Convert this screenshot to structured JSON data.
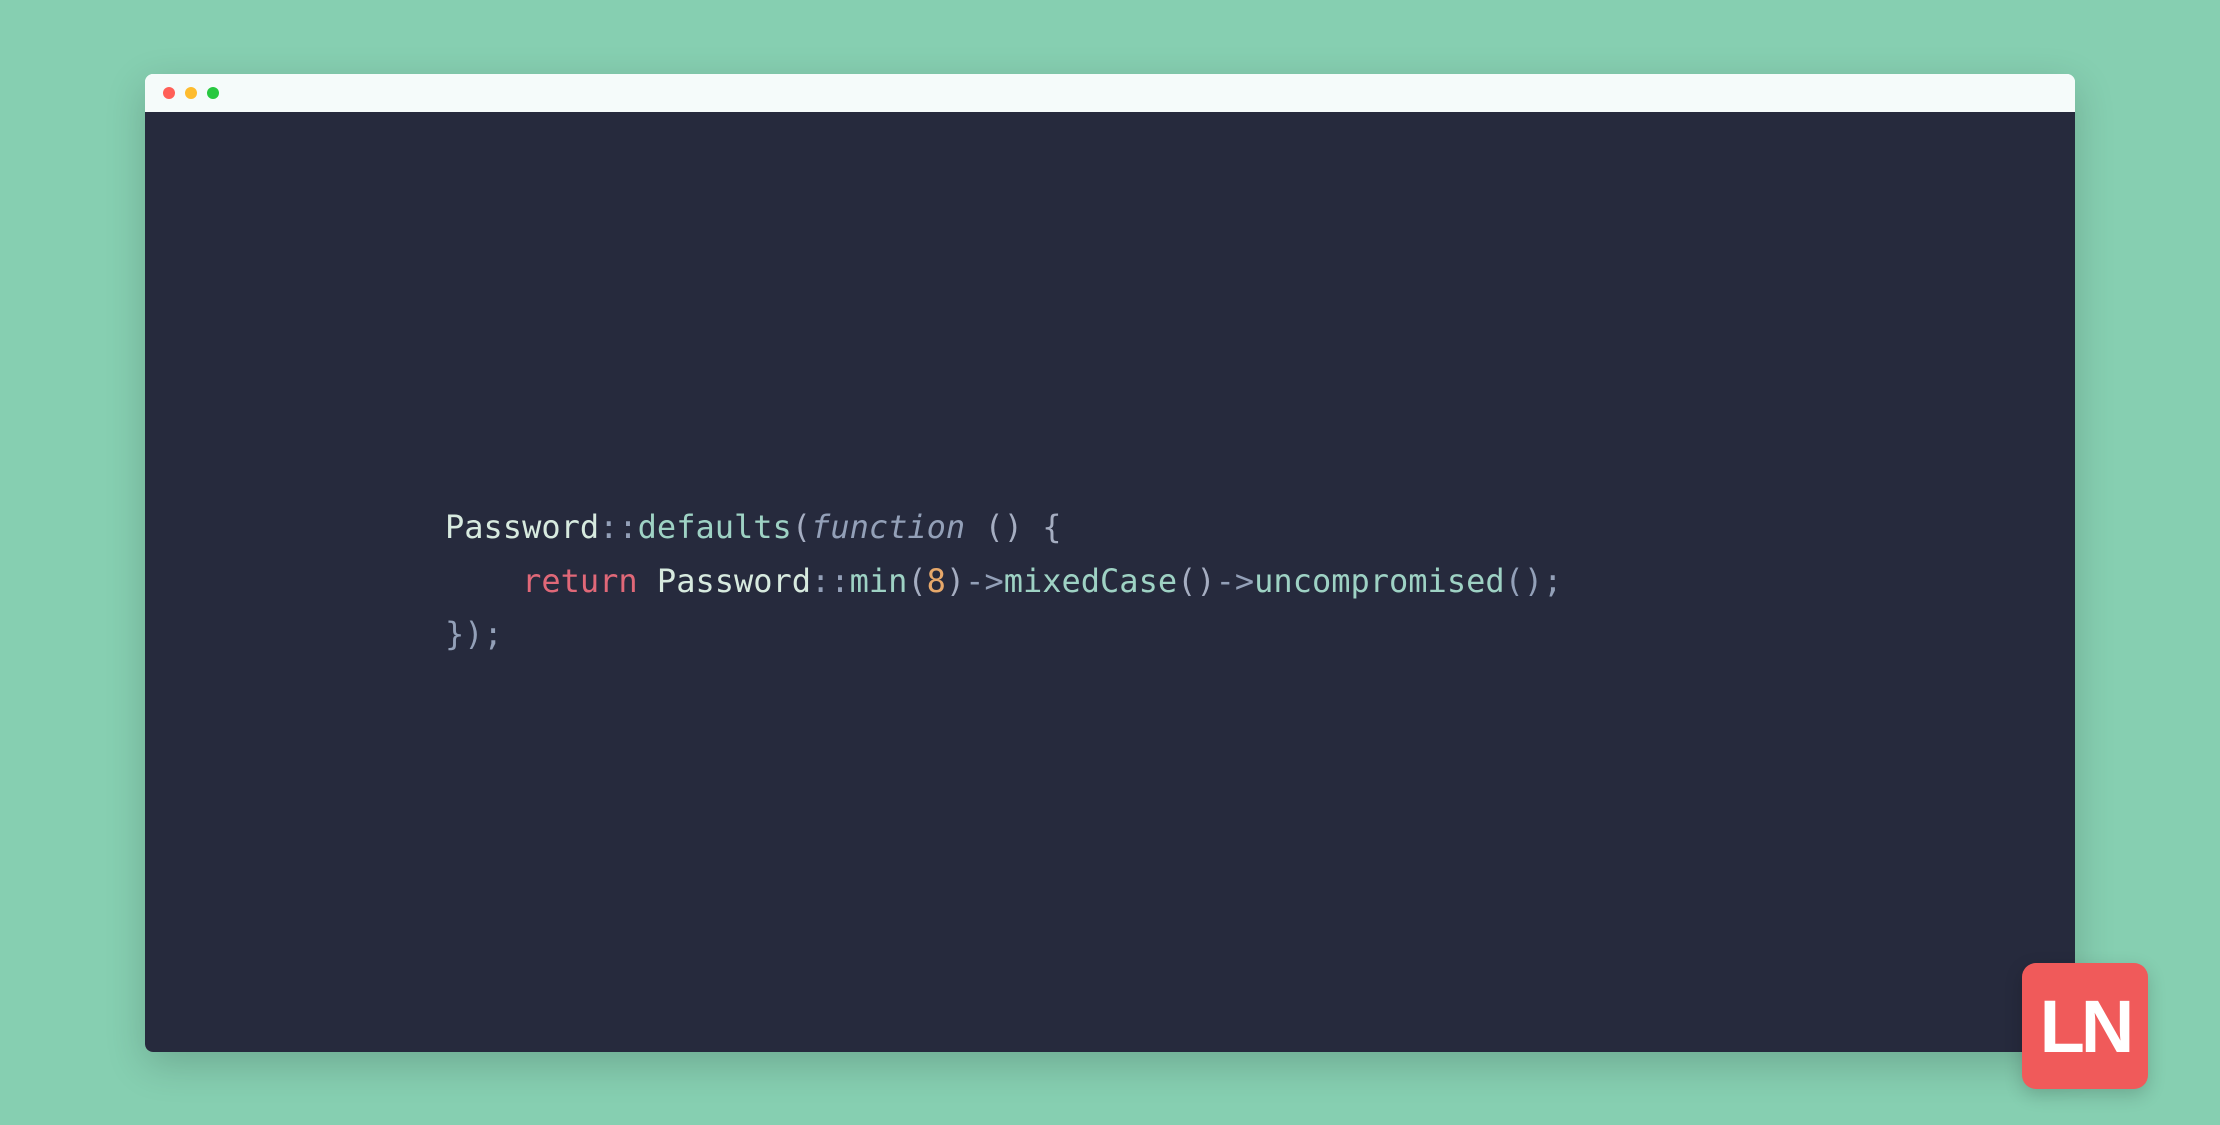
{
  "colors": {
    "page_bg": "#86cfb1",
    "editor_bg": "#262a3d",
    "titlebar_bg": "#f5fbfa",
    "logo_bg": "#f05a5a"
  },
  "traffic_lights": [
    "close",
    "minimize",
    "maximize"
  ],
  "code": {
    "line1": {
      "t1": "Password",
      "t2": "::",
      "t3": "defaults",
      "t4": "(",
      "t5": "function",
      "t6": " () {",
      "raw": "Password::defaults(function () {"
    },
    "line2": {
      "indent": "    ",
      "t1": "return",
      "t2": " Password",
      "t3": "::",
      "t4": "min",
      "t5": "(",
      "t6": "8",
      "t7": ")",
      "t8": "->",
      "t9": "mixedCase",
      "t10": "()",
      "t11": "->",
      "t12": "uncompromised",
      "t13": "();",
      "raw": "    return Password::min(8)->mixedCase()->uncompromised();"
    },
    "line3": {
      "t1": "});",
      "raw": "});"
    }
  },
  "logo": {
    "text": "LN"
  }
}
